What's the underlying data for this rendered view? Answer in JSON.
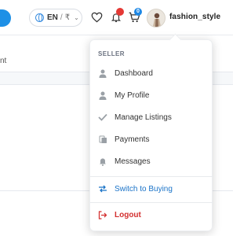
{
  "header": {
    "language": "EN",
    "currency": "₹",
    "cart_badge": "0",
    "notifications_badge": "",
    "username": "fashion_style"
  },
  "background": {
    "text_fragment": "nt"
  },
  "seller_menu": {
    "section_label": "SELLER",
    "items": [
      {
        "label": "Dashboard",
        "icon": "person-icon"
      },
      {
        "label": "My Profile",
        "icon": "person-icon"
      },
      {
        "label": "Manage Listings",
        "icon": "check-icon"
      },
      {
        "label": "Payments",
        "icon": "wallet-icon"
      },
      {
        "label": "Messages",
        "icon": "bell-icon"
      }
    ],
    "switch_label": "Switch to Buying",
    "logout_label": "Logout"
  },
  "colors": {
    "accent_blue": "#1a73c8",
    "logout_red": "#d32f2f",
    "badge_red": "#e53935",
    "badge_blue": "#1e88e5"
  }
}
